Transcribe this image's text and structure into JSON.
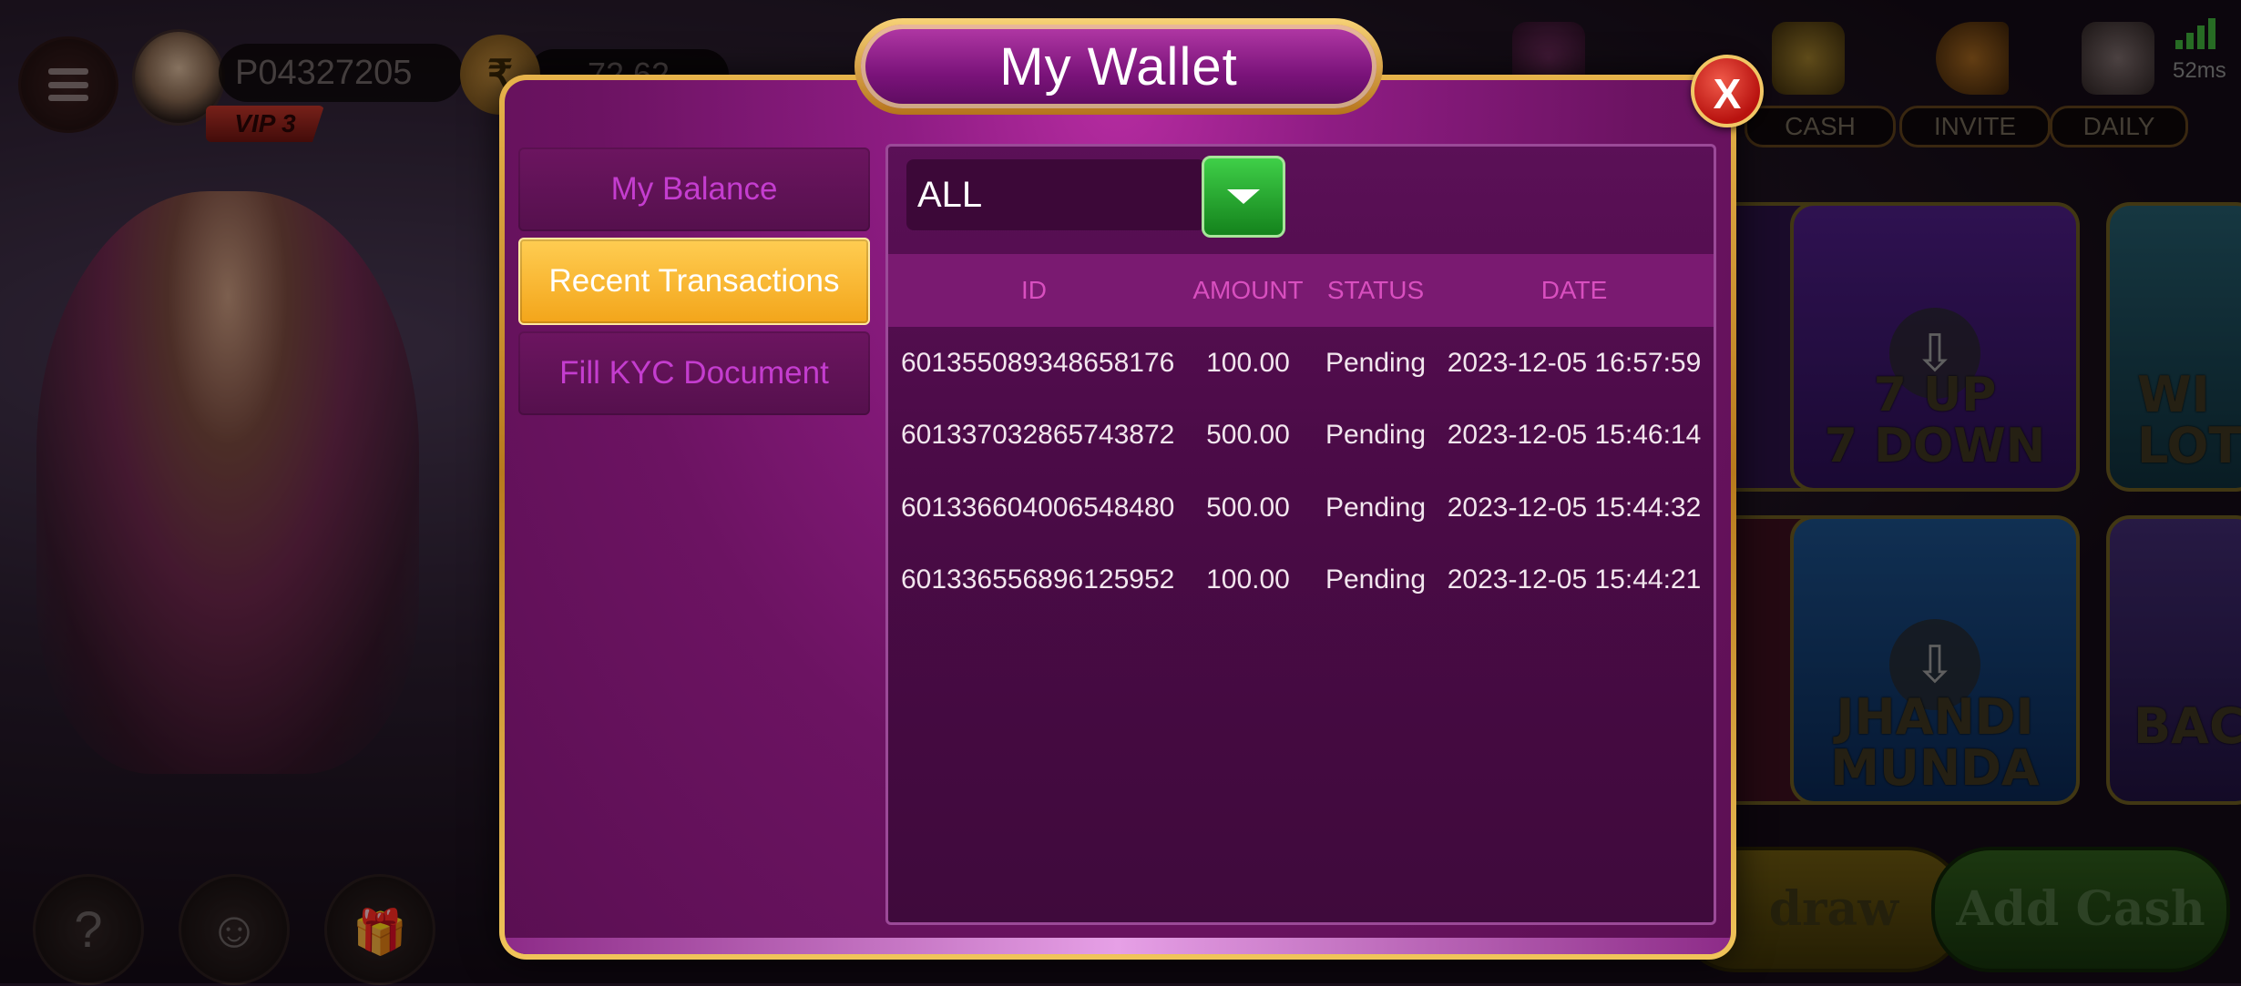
{
  "lobby": {
    "player_id": "P04327205",
    "vip_level": "VIP 3",
    "coin_symbol": "₹",
    "balance": "72.62",
    "top_labels": [
      "CASH",
      "INVITE",
      "DAILY"
    ],
    "ping": "52ms",
    "games": [
      {
        "title_line1": "7 UP",
        "title_line2": "7 DOWN",
        "color": "#2f1452"
      },
      {
        "title_line1": "WI",
        "title_line2": "LOTT",
        "color": "#1b3d4a"
      },
      {
        "title_line1": "JHANDI",
        "title_line2": "MUNDA",
        "color": "#0e2f55"
      },
      {
        "title_line1": "",
        "title_line2": "BACC",
        "color": "#2b1c46"
      }
    ],
    "withdraw_label": "draw",
    "add_cash_label": "Add Cash",
    "help_icon": "?",
    "support_icon": "☺",
    "gift_icon": "🎁",
    "download_icon": "⇩"
  },
  "modal": {
    "title": "My Wallet",
    "close_label": "X",
    "tabs": [
      {
        "label": "My Balance",
        "active": false
      },
      {
        "label": "Recent Transactions",
        "active": true
      },
      {
        "label": "Fill KYC Document",
        "active": false
      }
    ],
    "filter": {
      "selected": "ALL"
    },
    "table": {
      "headers": {
        "id": "ID",
        "amount": "AMOUNT",
        "status": "STATUS",
        "date": "DATE"
      },
      "rows": [
        {
          "id": "601355089348658176",
          "amount": "100.00",
          "status": "Pending",
          "date": "2023-12-05 16:57:59"
        },
        {
          "id": "601337032865743872",
          "amount": "500.00",
          "status": "Pending",
          "date": "2023-12-05 15:46:14"
        },
        {
          "id": "601336604006548480",
          "amount": "500.00",
          "status": "Pending",
          "date": "2023-12-05 15:44:32"
        },
        {
          "id": "601336556896125952",
          "amount": "100.00",
          "status": "Pending",
          "date": "2023-12-05 15:44:21"
        }
      ]
    }
  },
  "colors": {
    "accent_gold": "#f3a51a",
    "modal_purple": "#8e1c83",
    "tab_text": "#c43dcf",
    "header_text": "#d84fbf",
    "close_red": "#b8120f",
    "filter_green": "#14821c"
  }
}
